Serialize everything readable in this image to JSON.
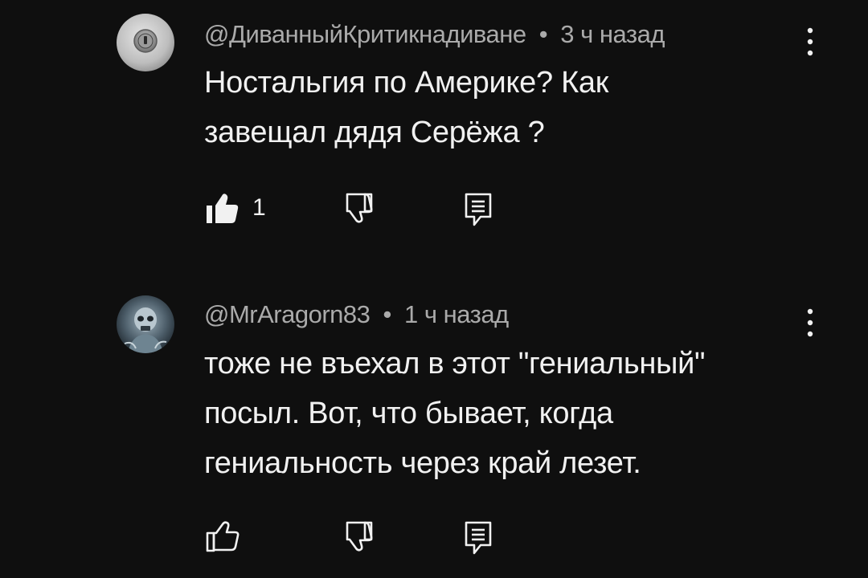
{
  "comments": [
    {
      "author": "@ДиванныйКритикнадиване",
      "separator": "•",
      "time": "3 ч назад",
      "lines": [
        "Ностальгия по Америке? Как",
        "завещал дядя Серёжа ?"
      ],
      "likes": "1",
      "avatar_icon": "lock-avatar-icon",
      "liked": true
    },
    {
      "author": "@MrAragorn83",
      "separator": "•",
      "time": "1 ч назад",
      "lines": [
        "тоже не въехал в этот \"гениальный\"",
        "посыл. Вот, что бывает, когда",
        "гениальность через край лезет."
      ],
      "likes": "",
      "avatar_icon": "skull-avatar-icon",
      "liked": false
    }
  ],
  "colors": {
    "background": "#0f0f0f",
    "text": "#f1f1f1",
    "meta": "#aaaaaa",
    "icon": "#f1f1f1"
  },
  "icons": {
    "like": "thumb-up-icon",
    "dislike": "thumb-down-icon",
    "reply": "reply-icon",
    "menu": "more-vert-icon"
  }
}
